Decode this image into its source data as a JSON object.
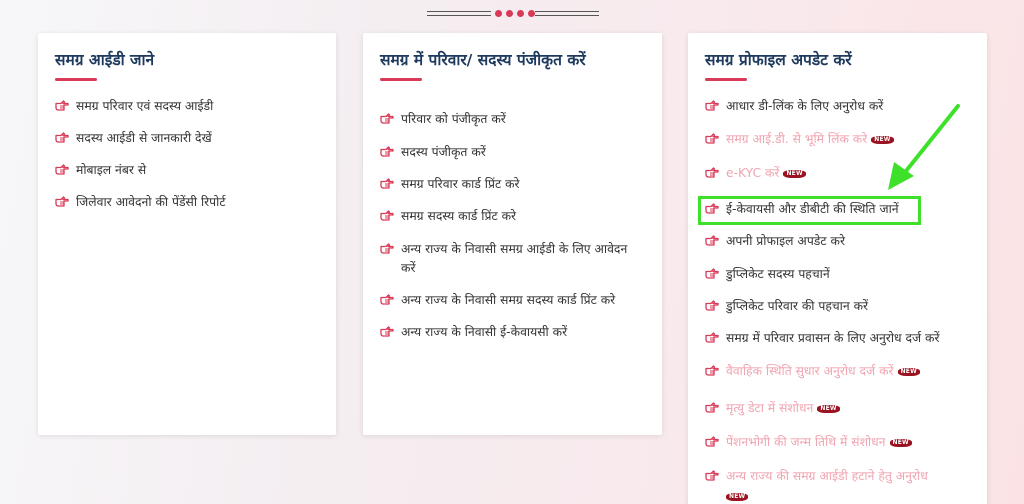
{
  "cards": [
    {
      "title": "समग्र आईडी जाने",
      "items": [
        {
          "label": "समग्र परिवार एवं सदस्य आईडी"
        },
        {
          "label": "सदस्य आईडी से जानकारी देखें"
        },
        {
          "label": "मोबाइल नंबर से"
        },
        {
          "label": "जिलेवार आवेदनो की पेंडेंसी रिपोर्ट"
        }
      ]
    },
    {
      "title": "समग्र में परिवार/ सदस्य पंजीकृत करें",
      "items": [
        {
          "label": "परिवार को पंजीकृत करें"
        },
        {
          "label": "सदस्य पंजीकृत करें"
        },
        {
          "label": "समग्र परिवार कार्ड प्रिंट करे"
        },
        {
          "label": "समग्र सदस्य कार्ड प्रिंट करे"
        },
        {
          "label": "अन्य राज्य के निवासी समग्र आईडी के लिए आवेदन करें"
        },
        {
          "label": "अन्य राज्य के निवासी समग्र सदस्य कार्ड प्रिंट करे"
        },
        {
          "label": "अन्य राज्य के निवासी ई-केवायसी करें"
        }
      ]
    },
    {
      "title": "समग्र प्रोफाइल अपडेट करें",
      "items": [
        {
          "label": "आधार डी-लिंक के लिए अनुरोध करें",
          "faded": false,
          "badge": ""
        },
        {
          "label": "समग्र आई.डी. से भूमि लिंक करे",
          "faded": true,
          "badge": "NEW"
        },
        {
          "label": "e-KYC करें",
          "faded": true,
          "badge": "NEW"
        },
        {
          "label": "ई-केवायसी और डीबीटी की स्थिति जानें",
          "faded": false,
          "badge": ""
        },
        {
          "label": "अपनी प्रोफाइल अपडेट करे",
          "faded": false,
          "badge": ""
        },
        {
          "label": "डुप्लिकेट सदस्य पहचानें",
          "faded": false,
          "badge": ""
        },
        {
          "label": "डुप्लिकेट परिवार की पहचान करें",
          "faded": false,
          "badge": ""
        },
        {
          "label": "समग्र में परिवार प्रवासन के लिए अनुरोध दर्ज करें",
          "faded": false,
          "badge": ""
        },
        {
          "label": "वैवाहिक स्थिति सुधार अनुरोध दर्ज करें",
          "faded": true,
          "badge": "NEW"
        },
        {
          "label": "मृत्यु डेटा में संशोधन",
          "faded": true,
          "badge": "NEW"
        },
        {
          "label": "पेंशनभोगी की जन्म तिथि में संशोधन",
          "faded": true,
          "badge": "NEW"
        },
        {
          "label": "अन्य राज्य की समग्र आईडी हटाने हेतु अनुरोध",
          "faded": true,
          "badge": "NEW"
        }
      ]
    }
  ],
  "colors": {
    "accent": "#d93a57",
    "title": "#1f3a5f",
    "faded": "#f0a4b0",
    "highlight": "#3ee02a",
    "badge": "#9b1320"
  }
}
